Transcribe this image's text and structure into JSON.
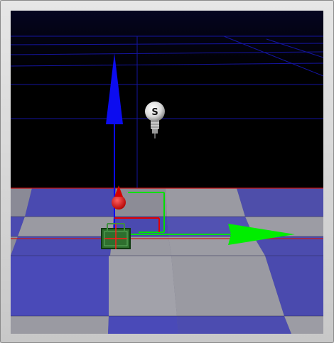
{
  "viewport": {
    "view": "3d-scene-editor-viewport",
    "background_color": "#000000",
    "floor_colors": [
      "#8e8e98",
      "#4f4fa0",
      "#3a3a8c"
    ],
    "grid_color": "#1a1ab8",
    "horizon_line_color": "#d01a1a"
  },
  "light": {
    "icon": "light-bulb-icon",
    "label": "S"
  },
  "gizmo": {
    "x_axis_color": "#00ff00",
    "y_axis_color": "#0000ff",
    "z_axis_color": "#ff0000",
    "object_color": "#2e6f2e"
  }
}
